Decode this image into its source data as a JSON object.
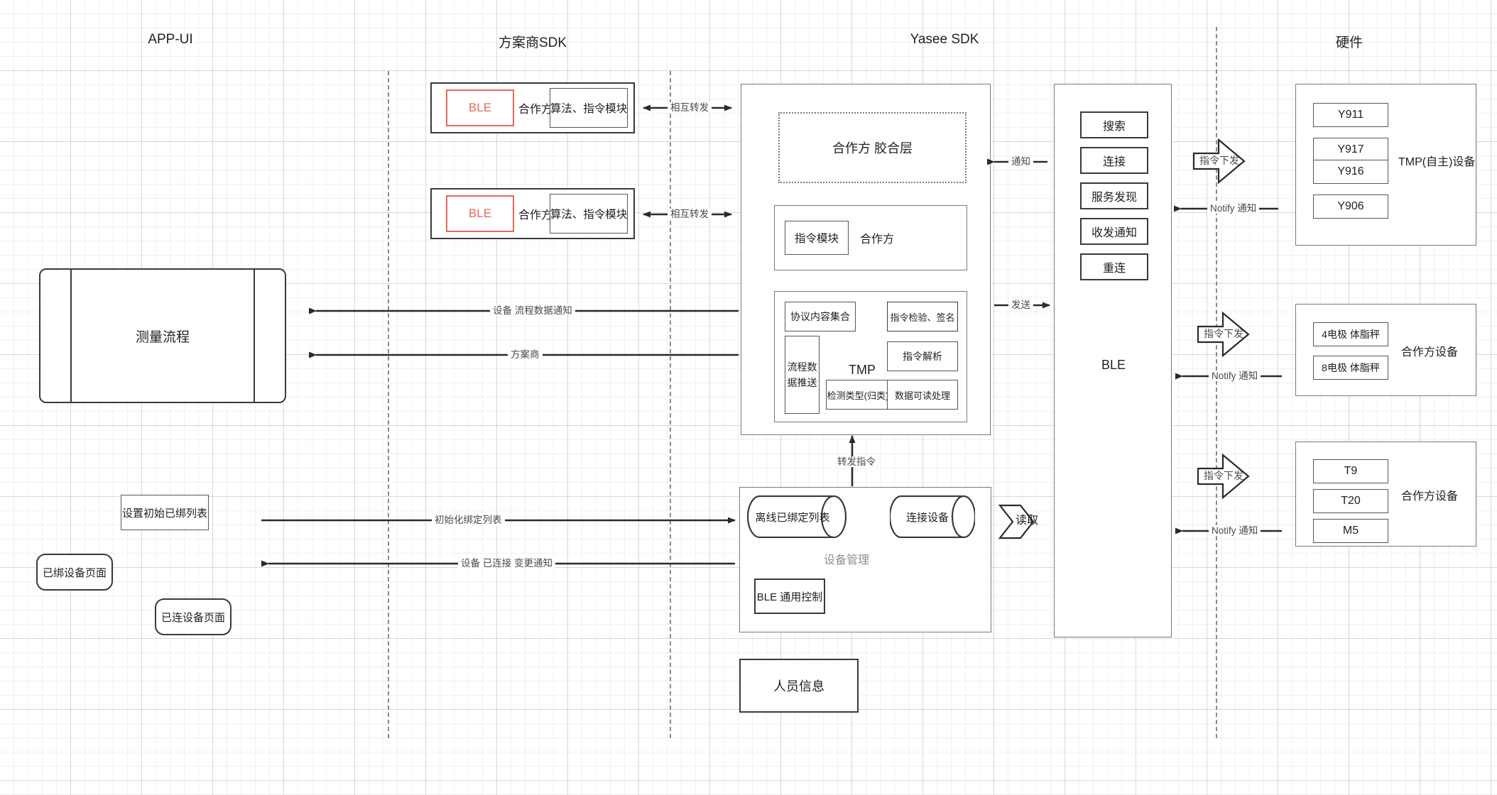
{
  "lanes": [
    {
      "title": "APP-UI"
    },
    {
      "title": "方案商SDK"
    },
    {
      "title": "Yasee SDK"
    },
    {
      "title": "硬件"
    }
  ],
  "app_ui": {
    "measure_flow": "测量流程",
    "set_initial_bound_list": "设置初始已绑列表",
    "bound_device_page": "已绑设备页面",
    "connected_device_page": "已连设备页面"
  },
  "partner_sdk": {
    "modules": [
      {
        "ble": "BLE",
        "partner": "合作方",
        "algo": "算法、指令模块"
      },
      {
        "ble": "BLE",
        "partner": "合作方",
        "algo": "算法、指令模块"
      }
    ]
  },
  "yasee_sdk": {
    "glue_layer": "合作方 胶合层",
    "command_module": "指令模块",
    "partner": "合作方",
    "tmp": {
      "title": "TMP",
      "protocol_set": "协议内容集合",
      "command_verify_sign": "指令检验、签名",
      "flow_data_push": "流程数据推送",
      "command_parse": "指令解析",
      "detect_type": "检测类型(归类)",
      "data_readable": "数据可读处理"
    },
    "device_manage": {
      "title": "设备管理",
      "offline_bound_list": "离线已绑定列表",
      "connected_device": "连接设备",
      "ble_general_control": "BLE 通用控制"
    },
    "person_info": "人员信息"
  },
  "ble_column": {
    "items": [
      "搜索",
      "连接",
      "服务发现",
      "收发通知",
      "重连"
    ],
    "footer": "BLE"
  },
  "hardware": {
    "groups": [
      {
        "label": "TMP(自主)设备",
        "devices": [
          "Y911",
          "Y917",
          "Y916",
          "Y906"
        ]
      },
      {
        "label": "合作方设备",
        "devices": [
          "4电极 体脂秤",
          "8电极 体脂秤"
        ]
      },
      {
        "label": "合作方设备",
        "devices": [
          "T9",
          "T20",
          "M5"
        ]
      }
    ],
    "command_down": "指令下发",
    "notify": "Notify 通知"
  },
  "connectors": {
    "mutual_forward": "相互转发",
    "notify": "通知",
    "send": "发送",
    "device_flow_data_notify": "设备 流程数据通知",
    "provider": "方案商",
    "forward_command": "转发指令",
    "init_bind_list": "初始化绑定列表",
    "device_connected_change_notify": "设备 已连接 变更通知",
    "read": "读取"
  },
  "colors": {
    "accent_red": "#e8675a",
    "stroke": "#3a3a3a",
    "muted": "#8e8e8e",
    "grid": "#e6e6e6"
  }
}
